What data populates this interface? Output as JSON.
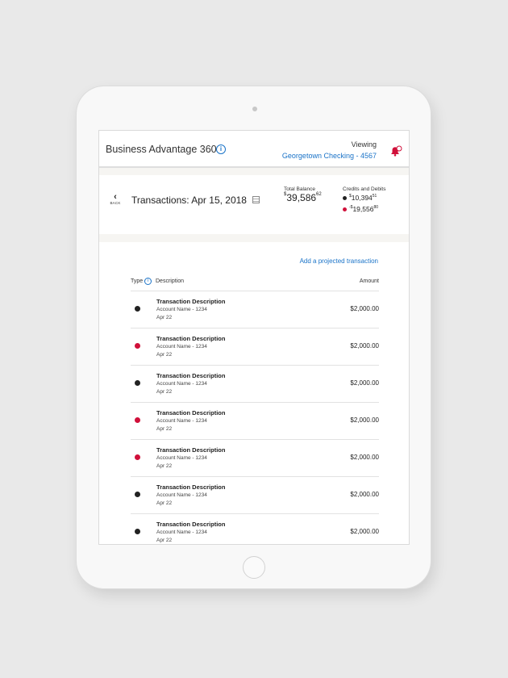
{
  "header": {
    "app_title": "Business Advantage 360",
    "viewing_label": "Viewing",
    "account_link": "Georgetown Checking - 4567"
  },
  "summary": {
    "back_label": "BACK",
    "title": "Transactions: Apr 15, 2018",
    "total_balance_label": "Total Balance",
    "total_balance_currency": "$",
    "total_balance_whole": "39,586",
    "total_balance_cents": "62",
    "credits_debits_label": "Credits and Debits",
    "credits_currency": "$",
    "credits_whole": "10,394",
    "credits_cents": "51",
    "debits_prefix": "-$",
    "debits_whole": "19,556",
    "debits_cents": "80"
  },
  "colors": {
    "credit": "#222222",
    "debit": "#d0103a",
    "link": "#1a73c8"
  },
  "content": {
    "add_link": "Add a projected transaction",
    "col_type": "Type",
    "col_description": "Description",
    "col_amount": "Amount",
    "rows": [
      {
        "kind": "credit",
        "description": "Transaction Description",
        "account": "Account Name - 1234",
        "date": "Apr 22",
        "amount": "$2,000.00"
      },
      {
        "kind": "debit",
        "description": "Transaction Description",
        "account": "Account Name - 1234",
        "date": "Apr 22",
        "amount": "$2,000.00"
      },
      {
        "kind": "credit",
        "description": "Transaction Description",
        "account": "Account Name - 1234",
        "date": "Apr 22",
        "amount": "$2,000.00"
      },
      {
        "kind": "debit",
        "description": "Transaction Description",
        "account": "Account Name - 1234",
        "date": "Apr 22",
        "amount": "$2,000.00"
      },
      {
        "kind": "debit",
        "description": "Transaction Description",
        "account": "Account Name - 1234",
        "date": "Apr 22",
        "amount": "$2,000.00"
      },
      {
        "kind": "credit",
        "description": "Transaction Description",
        "account": "Account Name - 1234",
        "date": "Apr 22",
        "amount": "$2,000.00"
      },
      {
        "kind": "credit",
        "description": "Transaction Description",
        "account": "Account Name - 1234",
        "date": "Apr 22",
        "amount": "$2,000.00"
      }
    ]
  }
}
